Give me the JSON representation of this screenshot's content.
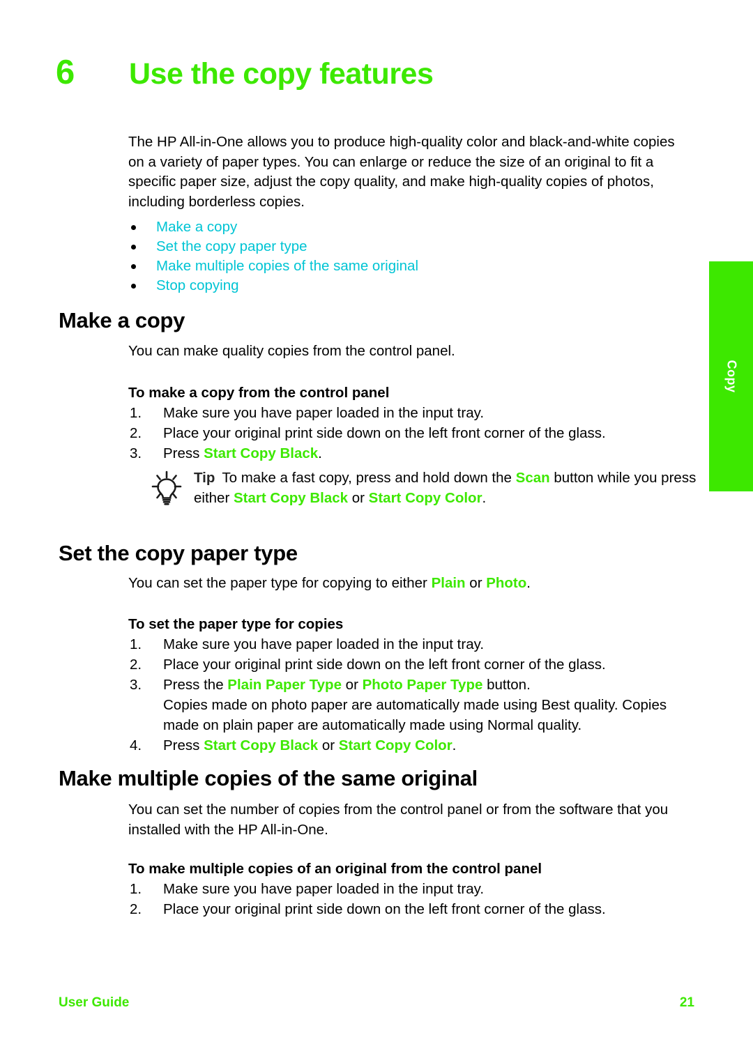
{
  "chapter": {
    "number": "6",
    "title": "Use the copy features"
  },
  "intro": {
    "paragraph": "The HP All-in-One allows you to produce high-quality color and black-and-white copies on a variety of paper types. You can enlarge or reduce the size of an original to fit a specific paper size, adjust the copy quality, and make high-quality copies of photos, including borderless copies."
  },
  "toc": {
    "items": [
      "Make a copy",
      "Set the copy paper type",
      "Make multiple copies of the same original",
      "Stop copying"
    ]
  },
  "sections": {
    "make_a_copy": {
      "heading": "Make a copy",
      "intro": "You can make quality copies from the control panel.",
      "procedure_title": "To make a copy from the control panel",
      "steps": [
        {
          "num": "1.",
          "text": "Make sure you have paper loaded in the input tray."
        },
        {
          "num": "2.",
          "text": "Place your original print side down on the left front corner of the glass."
        }
      ],
      "step3": {
        "num": "3.",
        "prefix": "Press ",
        "ui": "Start Copy Black",
        "suffix": "."
      },
      "tip": {
        "label": "Tip",
        "part1": "To make a fast copy, press and hold down the ",
        "ui1": "Scan",
        "part2": " button while you press either ",
        "ui2": "Start Copy Black",
        "part3": " or ",
        "ui3": "Start Copy Color",
        "part4": "."
      }
    },
    "set_paper_type": {
      "heading": "Set the copy paper type",
      "intro_prefix": "You can set the paper type for copying to either ",
      "intro_ui1": "Plain",
      "intro_mid": " or ",
      "intro_ui2": "Photo",
      "intro_suffix": ".",
      "procedure_title": "To set the paper type for copies",
      "steps": [
        {
          "num": "1.",
          "text": "Make sure you have paper loaded in the input tray."
        },
        {
          "num": "2.",
          "text": "Place your original print side down on the left front corner of the glass."
        }
      ],
      "step3": {
        "num": "3.",
        "prefix": "Press the ",
        "ui1": "Plain Paper Type",
        "mid": " or ",
        "ui2": "Photo Paper Type",
        "suffix": " button.",
        "note": "Copies made on photo paper are automatically made using Best quality. Copies made on plain paper are automatically made using Normal quality."
      },
      "step4": {
        "num": "4.",
        "prefix": "Press ",
        "ui1": "Start Copy Black",
        "mid": " or ",
        "ui2": "Start Copy Color",
        "suffix": "."
      }
    },
    "multiple_copies": {
      "heading": "Make multiple copies of the same original",
      "intro": "You can set the number of copies from the control panel or from the software that you installed with the HP All-in-One.",
      "procedure_title": "To make multiple copies of an original from the control panel",
      "steps": [
        {
          "num": "1.",
          "text": "Make sure you have paper loaded in the input tray."
        },
        {
          "num": "2.",
          "text": "Place your original print side down on the left front corner of the glass."
        }
      ]
    }
  },
  "side_tab": {
    "label": "Copy"
  },
  "footer": {
    "label": "User Guide",
    "page_number": "21"
  },
  "colors": {
    "accent_green": "#3DE800",
    "link_cyan": "#00C4D4",
    "tab_green": "#3DE800"
  }
}
